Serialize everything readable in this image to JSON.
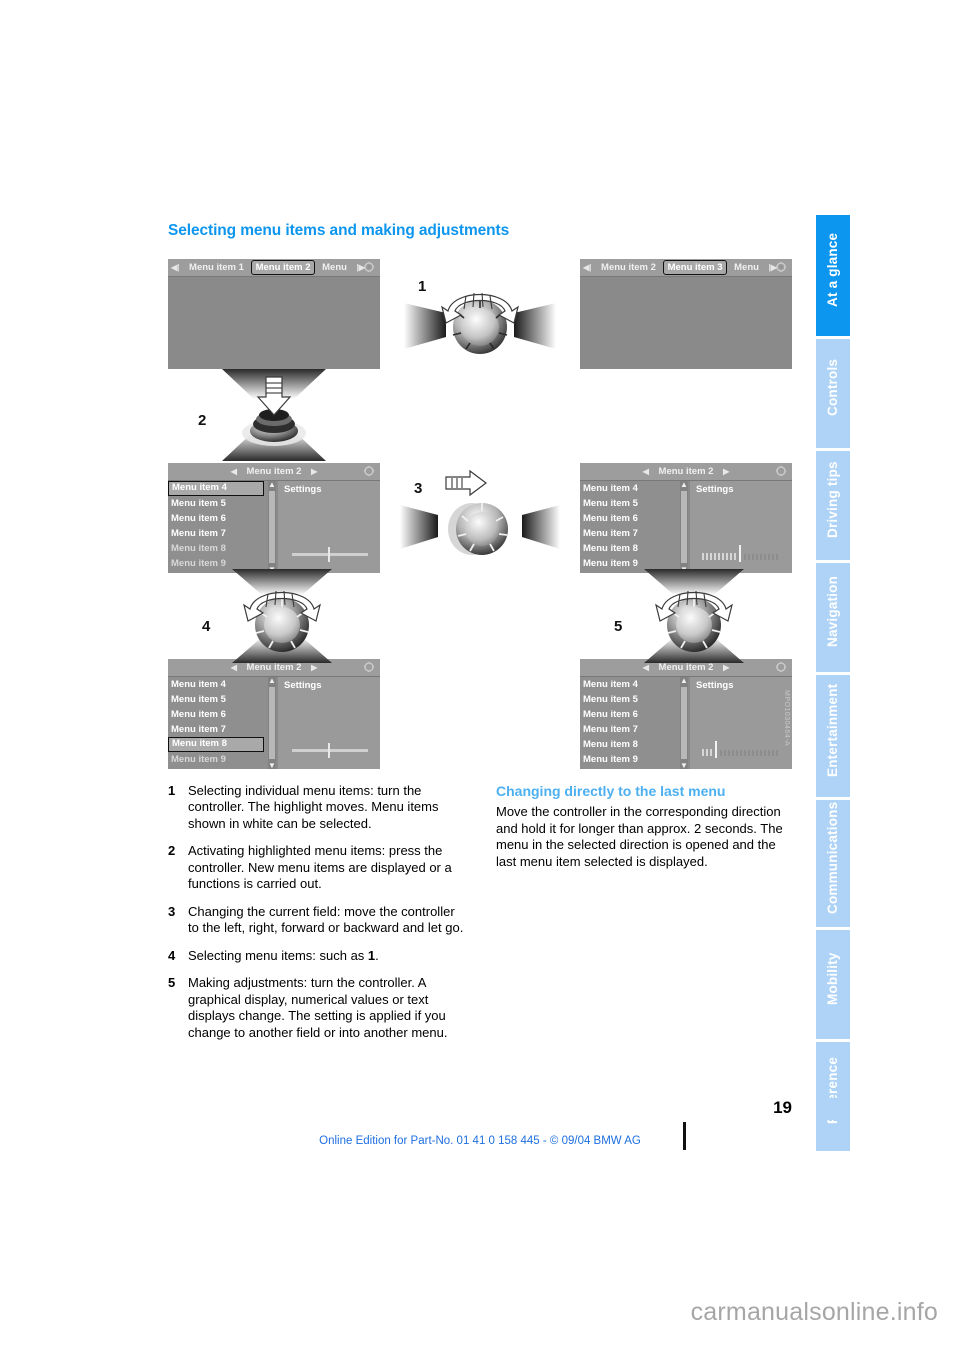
{
  "page": {
    "section_title": "Selecting menu items and making adjustments",
    "page_number": "19",
    "footer_note": "Online Edition for Part-No. 01 41 0 158 445 - © 09/04 BMW AG",
    "figure_id": "MPO1030464-A",
    "watermark": "carmanualsonline.info",
    "accent_color": "#0d96ef",
    "subhead_color": "#4cb0f0",
    "footer_color": "#1e6fe0"
  },
  "tabs": [
    {
      "label": "At a glance",
      "active": true
    },
    {
      "label": "Controls",
      "active": false
    },
    {
      "label": "Driving tips",
      "active": false
    },
    {
      "label": "Navigation",
      "active": false
    },
    {
      "label": "Entertainment",
      "active": false
    },
    {
      "label": "Communications",
      "active": false
    },
    {
      "label": "Mobility",
      "active": false
    },
    {
      "label": "Reference",
      "active": false
    }
  ],
  "figure": {
    "callouts": [
      "1",
      "2",
      "3",
      "4",
      "5"
    ],
    "screens": {
      "top_left": {
        "titlebar": {
          "left_item": "Menu item 1",
          "selected_item": "Menu item 2",
          "right_item": "Menu"
        }
      },
      "top_right": {
        "titlebar": {
          "left_item": "Menu item 2",
          "selected_item": "Menu item 3",
          "right_item": "Menu"
        }
      },
      "mid_left": {
        "title": "Menu item 2",
        "settings_label": "Settings",
        "items": [
          "Menu item 4",
          "Menu item 5",
          "Menu item 6",
          "Menu item 7",
          "Menu item 8",
          "Menu item 9"
        ],
        "highlighted": "Menu item 4",
        "widget": "slider"
      },
      "mid_right": {
        "title": "Menu item 2",
        "settings_label": "Settings",
        "items": [
          "Menu item 4",
          "Menu item 5",
          "Menu item 6",
          "Menu item 7",
          "Menu item 8",
          "Menu item 9"
        ],
        "highlighted": "Menu item 4",
        "widget": "barmeter"
      },
      "bottom_left": {
        "title": "Menu item 2",
        "settings_label": "Settings",
        "items": [
          "Menu item 4",
          "Menu item 5",
          "Menu item 6",
          "Menu item 7",
          "Menu item 8",
          "Menu item 9"
        ],
        "highlighted": "Menu item 8",
        "widget": "slider"
      },
      "bottom_right": {
        "title": "Menu item 2",
        "settings_label": "Settings",
        "items": [
          "Menu item 4",
          "Menu item 5",
          "Menu item 6",
          "Menu item 7",
          "Menu item 8",
          "Menu item 9"
        ],
        "highlighted": "Menu item 4",
        "widget": "barmeter_low"
      }
    }
  },
  "left_column": {
    "steps": [
      {
        "n": "1",
        "text": "Selecting individual menu items: turn the controller. The highlight moves. Menu items shown in white can be selected."
      },
      {
        "n": "2",
        "text": "Activating highlighted menu items: press the controller. New menu items are displayed or a functions is carried out."
      },
      {
        "n": "3",
        "text": "Changing the current field: move the controller to the left, right, forward or backward and let go."
      },
      {
        "n": "4",
        "text_pre": "Selecting menu items: such as ",
        "text_bold": "1",
        "text_post": "."
      },
      {
        "n": "5",
        "text": "Making adjustments: turn the controller. A graphical display, numerical values or text displays change. The setting is applied if you change to another field or into another menu."
      }
    ]
  },
  "right_column": {
    "heading": "Changing directly to the last menu",
    "paragraph": "Move the controller in the corresponding direction and hold it for longer than approx. 2 seconds. The menu in the selected direction is opened and the last menu item selected is displayed."
  }
}
